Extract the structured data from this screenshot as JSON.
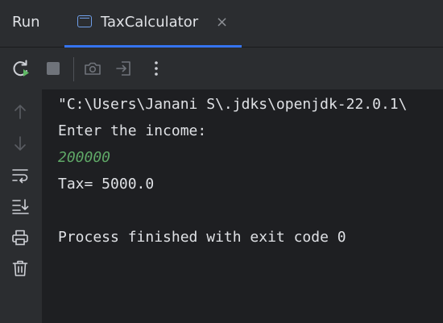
{
  "header": {
    "run_label": "Run",
    "tab_label": "TaxCalculator",
    "tab_close": "×"
  },
  "toolbar": {
    "icons": [
      "rerun-icon",
      "stop-icon",
      "camera-icon",
      "exit-icon",
      "more-options-icon"
    ],
    "more_glyph": "⋮"
  },
  "sidebar": {
    "icons": [
      "arrow-up-icon",
      "arrow-down-icon",
      "soft-wrap-icon",
      "scroll-to-end-icon",
      "print-icon",
      "trash-icon"
    ]
  },
  "console": {
    "lines": [
      "\"C:\\Users\\Janani S\\.jdks\\openjdk-22.0.1\\",
      "Enter the income:",
      "200000",
      "Tax= 5000.0",
      "",
      "Process finished with exit code 0"
    ]
  },
  "colors": {
    "background": "#1e1f22",
    "panel": "#2b2d30",
    "accent": "#3574f0",
    "input_text": "#5fa867",
    "text": "#dfe1e5"
  }
}
